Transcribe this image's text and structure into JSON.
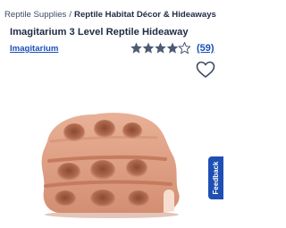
{
  "breadcrumb": {
    "items": [
      "Reptile Supplies",
      "Reptile Habitat Décor & Hideaways"
    ],
    "separator": "/"
  },
  "product": {
    "title": "Imagitarium 3 Level Reptile Hideaway",
    "brand": "Imagitarium",
    "rating": 4.5,
    "rating_max": 5,
    "review_count": "(59)",
    "image_icon": "reptile-hideaway-image"
  },
  "feedback": {
    "label": "Feedback"
  },
  "colors": {
    "star": "#4d5a73",
    "link": "#1a4fb8",
    "feedback_bg": "#1f4fb3"
  }
}
